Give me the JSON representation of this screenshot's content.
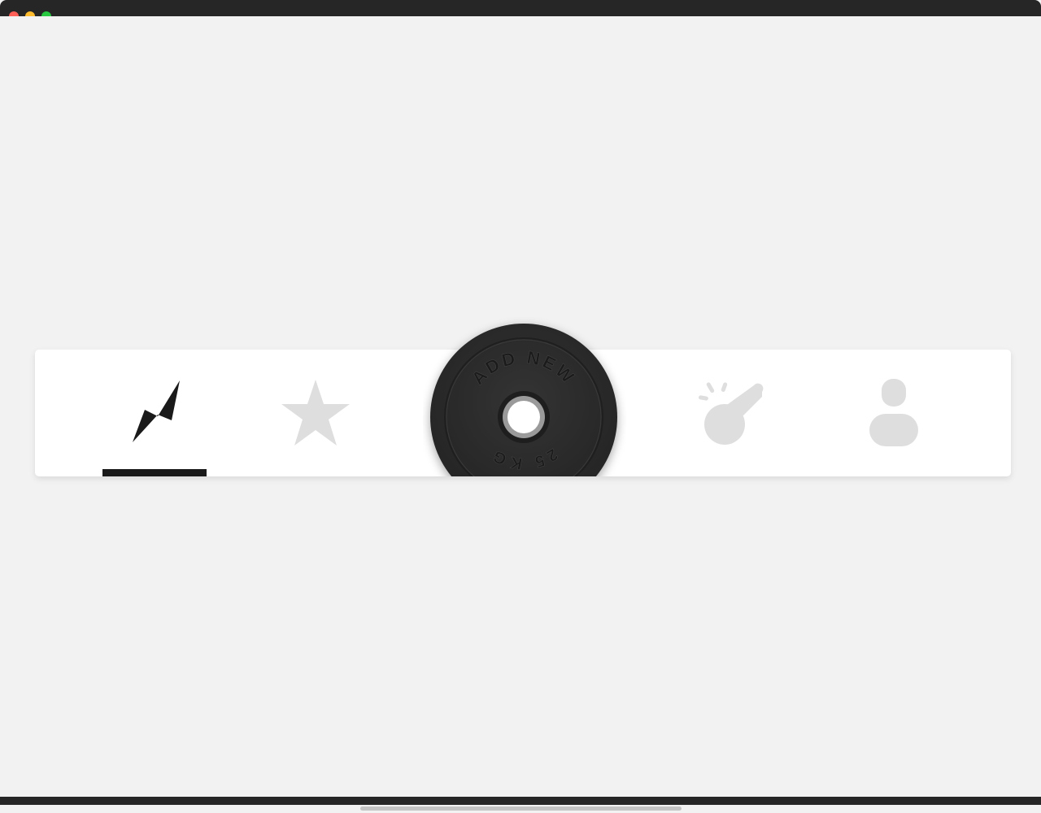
{
  "window": {
    "controls": [
      "close",
      "minimize",
      "maximize"
    ]
  },
  "tabbar": {
    "active_index": 0,
    "tabs": [
      {
        "icon": "lightning-icon",
        "color": "#1a1a1a",
        "active": true
      },
      {
        "icon": "star-icon",
        "color": "#dedede",
        "active": false
      },
      {
        "icon": "whistle-icon",
        "color": "#dedede",
        "active": false
      },
      {
        "icon": "user-icon",
        "color": "#dedede",
        "active": false
      }
    ]
  },
  "add_button": {
    "top_text": "ADD NEW",
    "bottom_text": "25 KG",
    "plate_color": "#2b2b2b"
  },
  "colors": {
    "background": "#f2f2f2",
    "bar": "#ffffff",
    "active": "#1a1a1a",
    "inactive": "#dedede"
  }
}
